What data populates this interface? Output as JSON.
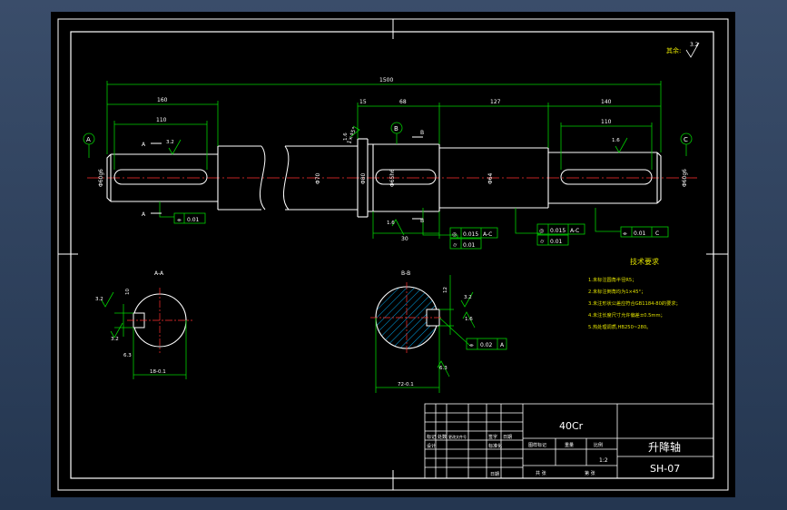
{
  "drawing": {
    "roughness_note": "其余:",
    "roughness_value": "3.2",
    "material": "40Cr",
    "part_name": "升降轴",
    "drawing_no": "SH-07",
    "scale": "1:2"
  },
  "dimensions": {
    "overall": "1500",
    "left_end": "160",
    "left_key": "110",
    "d_15": "15",
    "d_68": "68",
    "d_127": "127",
    "right_end": "140",
    "right_key": "110",
    "d_30": "30",
    "dia_left": "Φ60g6",
    "dia_mid": "Φ70",
    "dia_collar": "Φ80",
    "dia_bearing": "Φ65h6",
    "dia_right_mid": "Φ64",
    "dia_right": "Φ60g6",
    "chamfer": "1×45°"
  },
  "datums": {
    "a": "A",
    "b": "B",
    "c": "C",
    "section_a": "A",
    "section_b": "B"
  },
  "roughness": {
    "r1": "3.2",
    "r2": "1.6",
    "r3": "1.6",
    "r4": "1.6",
    "r5": "3.2",
    "r6": "1.6",
    "r7": "6.3"
  },
  "tolerances": {
    "sym_left": "0.01",
    "runout_bearing": "0.015",
    "runout_bearing_ref": "A-C",
    "cyl_bearing": "0.01",
    "runout_mid": "0.015",
    "runout_mid_ref": "A-C",
    "cyl_mid": "0.01",
    "par_right": "0.01",
    "par_right_ref": "C",
    "sym_section_b": "0.02",
    "sym_section_b_ref": "A"
  },
  "sections": {
    "a_title": "A-A",
    "b_title": "B-B",
    "a_width": "18-0.1",
    "b_width": "72-0.1",
    "a_depth": "10",
    "b_depth": "12",
    "a_r": "3.2",
    "b_r": "3.2"
  },
  "technical_requirements": {
    "title": "技术要求",
    "items": [
      "1.未标注圆角半径R5；",
      "2.未标注倒角均为1×45°；",
      "3.未注形状公差应符合GB1184-80的要求；",
      "4.未注长度尺寸允许偏差±0.5mm；",
      "5.热处理调质,HB250~280。"
    ]
  },
  "title_block": {
    "row1": [
      "标记",
      "处数",
      "更改文件号",
      "签字",
      "日期"
    ],
    "row2_labels": [
      "设计",
      "标准化"
    ],
    "cells": [
      "图样标记",
      "重量",
      "比例"
    ],
    "bottom": [
      "共 张",
      "第 张"
    ],
    "date_label": "日期"
  }
}
